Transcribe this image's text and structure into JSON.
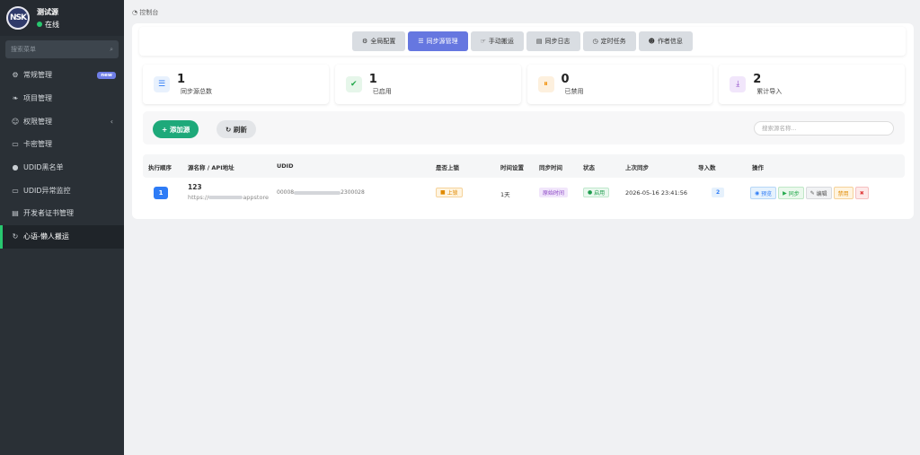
{
  "sidebar": {
    "logo_text": "NSK",
    "brand_name": "测试源",
    "status": "在线",
    "search_placeholder": "搜索菜单",
    "items": [
      {
        "label": "常规管理",
        "icon": "gears-icon",
        "badge": "new"
      },
      {
        "label": "项目管理",
        "icon": "leaf-icon"
      },
      {
        "label": "权限管理",
        "icon": "users-icon"
      },
      {
        "label": "卡密管理",
        "icon": "card-icon"
      },
      {
        "label": "UDID黑名单",
        "icon": "bomb-icon"
      },
      {
        "label": "UDID异常监控",
        "icon": "monitor-icon"
      },
      {
        "label": "开发者证书管理",
        "icon": "file-icon"
      },
      {
        "label": "心语-懒人搬运",
        "icon": "sync-icon"
      }
    ]
  },
  "breadcrumb": "控制台",
  "tabs": [
    {
      "label": "全局配置",
      "icon": "gear-icon"
    },
    {
      "label": "同步源管理",
      "icon": "database-icon",
      "active": true
    },
    {
      "label": "手动搬运",
      "icon": "hand-icon"
    },
    {
      "label": "同步日志",
      "icon": "log-icon"
    },
    {
      "label": "定时任务",
      "icon": "clock-icon"
    },
    {
      "label": "作者信息",
      "icon": "user-icon"
    }
  ],
  "stats": [
    {
      "value": "1",
      "label": "同步源总数",
      "icon": "database-icon",
      "color": "#2e7cf6",
      "bg": "#e8f1fd"
    },
    {
      "value": "1",
      "label": "已启用",
      "icon": "check-circle-icon",
      "color": "#22a84a",
      "bg": "#e6f6ea"
    },
    {
      "value": "0",
      "label": "已禁用",
      "icon": "pause-circle-icon",
      "color": "#f08c00",
      "bg": "#fdf0de"
    },
    {
      "value": "2",
      "label": "累计导入",
      "icon": "download-icon",
      "color": "#8a45c4",
      "bg": "#f1e6fb"
    }
  ],
  "toolbar": {
    "add_label": "添加源",
    "refresh_label": "刷新",
    "search_placeholder": "搜索源名称..."
  },
  "table": {
    "headers": [
      "执行顺序",
      "源名称 / API地址",
      "UDID",
      "是否上锁",
      "时间设置",
      "同步时间",
      "状态",
      "上次同步",
      "导入数",
      "操作"
    ],
    "row": {
      "order": "1",
      "name": "123",
      "api_prefix": "https://",
      "api_suffix": "appstore",
      "udid_prefix": "00008",
      "udid_suffix": "2300028",
      "lock": "上锁",
      "time_setting": "1天",
      "sync_time": "原始时间",
      "status": "启用",
      "last_sync": "2026-05-16 23:41:56",
      "imported": "2",
      "actions": {
        "preview": "预览",
        "sync": "同步",
        "edit": "编辑",
        "disable": "禁用"
      }
    }
  }
}
